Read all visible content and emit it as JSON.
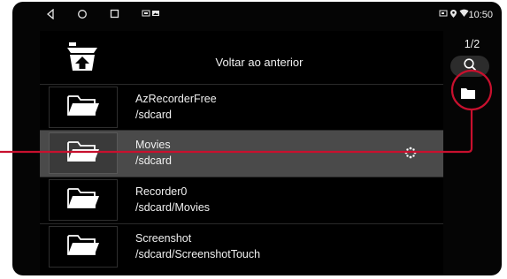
{
  "status_bar": {
    "time": "10:50",
    "nav_icons": [
      "back-triangle-icon",
      "home-circle-icon",
      "recents-square-icon"
    ],
    "notification_icons": [
      "screenshot-notification-icon",
      "image-notification-icon"
    ],
    "system_icons": [
      "cast-icon",
      "location-icon",
      "wifi-icon"
    ]
  },
  "file_browser": {
    "back_label": "Voltar ao anterior",
    "page_indicator": "1/2",
    "items": [
      {
        "name": "AzRecorderFree",
        "path": "/sdcard",
        "selected": false
      },
      {
        "name": "Movies",
        "path": "/sdcard",
        "selected": true
      },
      {
        "name": "Recorder0",
        "path": "/sdcard/Movies",
        "selected": false
      },
      {
        "name": "Screenshot",
        "path": "/sdcard/ScreenshotTouch",
        "selected": false
      }
    ]
  },
  "annotation": {
    "color": "#c8102e"
  }
}
